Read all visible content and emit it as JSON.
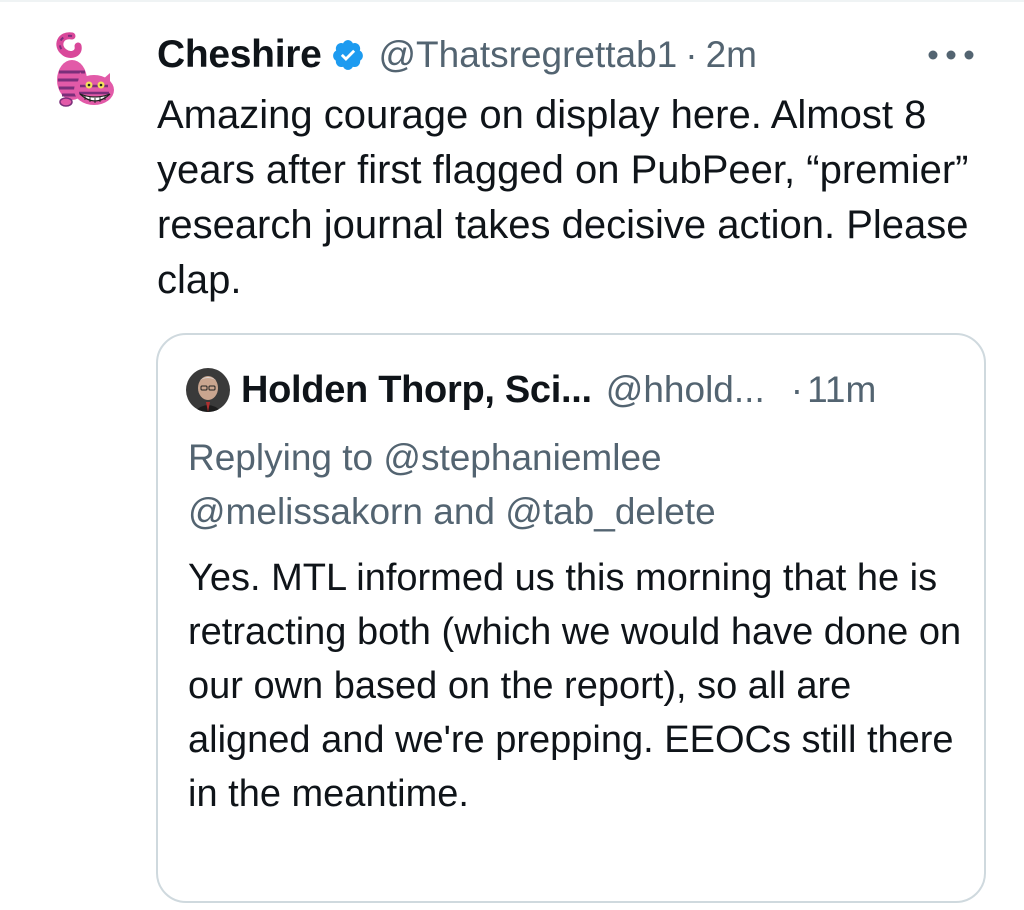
{
  "tweet": {
    "display_name": "Cheshire",
    "handle": "@Thatsregrettab1",
    "separator": "·",
    "time": "2m",
    "text": "Amazing courage on display here. Almost 8 years after first flagged on PubPeer, “premier” research journal takes decisive action. Please clap.",
    "avatar_icon": "cheshire-cat-avatar",
    "verified_icon": "verified-badge-icon",
    "more_icon": "more-options-icon"
  },
  "quote": {
    "display_name": "Holden Thorp, Sci...",
    "handle": "@hhold...",
    "separator": "·",
    "time": "11m",
    "replying_prefix": "Replying to",
    "mention_1": "@stephaniemlee",
    "mention_2": "@melissakorn",
    "and_word": "and",
    "mention_3": "@tab_delete",
    "text": "Yes.  MTL informed us this morning that he is retracting both (which we would have done on our own based on the report), so all are aligned and we're prepping.  EEOCs still there in the meantime."
  },
  "colors": {
    "primary_text": "#0f1419",
    "secondary_text": "#536471",
    "verified_blue": "#1d9bf0",
    "card_border": "#cfd9de"
  }
}
